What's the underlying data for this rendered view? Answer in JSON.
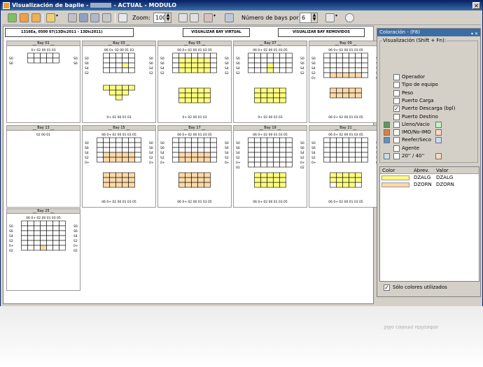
{
  "window": {
    "title": "Visualización de baplie -",
    "title_tail": "- ACTUAL - MODULO",
    "close": "✕"
  },
  "toolbar": {
    "zoom_label": "Zoom:",
    "zoom_value": "100",
    "bays_label": "Número de bays por fila:",
    "bays_value": "6"
  },
  "main": {
    "info_text": "1316Ea, 0500 07(13Dic2011 - 13Dic2011)",
    "btn_virtual": "VISUALIZAR BAY VIRTUAL",
    "btn_removidos": "VISUALIZAR BAY REMOVIDOS",
    "bays": [
      {
        "title": "__ Bay 01 __",
        "deck_cols": "0+ 02 00 01 03",
        "under_cols": ""
      },
      {
        "title": "__ Bay 03 __",
        "deck_cols": "06 0+ 02 00 01 03",
        "under_cols": "0+ 02 00 01 03"
      },
      {
        "title": "__ Bay 05 __",
        "deck_cols": "06 0+ 02 00 01 03 05",
        "under_cols": "0+ 02 00 01 03"
      },
      {
        "title": "__ Bay 07 __",
        "deck_cols": "06 0+ 02 00 01 03 05",
        "under_cols": "0+ 02 00 01 03"
      },
      {
        "title": "__ Bay 09 __",
        "deck_cols": "06 0+ 02 00 01 03 05",
        "under_cols": "06 0+ 02 00 01 03 05"
      },
      {
        "title": "__ Bay 13 __",
        "deck_cols": "02 00 01",
        "under_cols": ""
      },
      {
        "title": "__ Bay 15 __",
        "deck_cols": "06 0+ 02 00 01 03 05",
        "under_cols": "06 0+ 02 00 01 03 05"
      },
      {
        "title": "__ Bay 17 __",
        "deck_cols": "06 0+ 02 00 01 03 05",
        "under_cols": "06 0+ 02 00 01 03 05"
      },
      {
        "title": "__ Bay 19 __",
        "deck_cols": "06 0+ 02 00 01 03 05",
        "under_cols": "06 0+ 02 00 01 03 05"
      },
      {
        "title": "__ Bay 19 __",
        "deck_cols": "06 0+ 02 00 01 03 05",
        "under_cols": "06 0+ 02 00 01 03 05"
      },
      {
        "title": "__ Bay 21 __",
        "deck_cols": "06 0+ 02 00 01 03 05",
        "under_cols": "06 0+ 02 00 01 03 05"
      },
      {
        "title": "__ Bay 25 __",
        "deck_cols": "06 0+ 02 00 01 03 05",
        "under_cols": ""
      }
    ]
  },
  "side": {
    "header": "Coloración - (F8)",
    "group_label": "Visualización (Shift + Fn):",
    "options": [
      {
        "label": "Operador",
        "checked": false
      },
      {
        "label": "Tipo de equipo",
        "checked": false
      },
      {
        "label": "Peso",
        "checked": false
      },
      {
        "label": "Puerto Carga",
        "checked": false
      },
      {
        "label": "Puerto Descarga (bpl)",
        "checked": true
      },
      {
        "label": "Puerto Destino",
        "checked": false
      },
      {
        "label": "Lleno/Vacio",
        "checked": false
      },
      {
        "label": "IMO/No-IMO",
        "checked": false
      },
      {
        "label": "Reefer/Seco",
        "checked": false
      },
      {
        "label": "Agente",
        "checked": false
      },
      {
        "label": "20'' / 40''",
        "checked": false
      }
    ],
    "table_headers": [
      "Color",
      "Abrev.",
      "Valor"
    ],
    "legend": [
      {
        "color": "#ffff80",
        "abrev": "DZALG",
        "valor": "DZALG"
      },
      {
        "color": "#fdd9a8",
        "abrev": "DZORN",
        "valor": "DZORN"
      }
    ],
    "only_used": "Sólo colores utilizados",
    "colors": {
      "lleno": "#5a9a5a",
      "lleno2": "#c8f0c8",
      "imo": "#e08040",
      "imo2": "#f8d8c0",
      "reefer": "#6090c0",
      "reefer2": "#c8dcf0",
      "size20": "#c8dcf0",
      "size40": "#f8d8c0"
    }
  }
}
